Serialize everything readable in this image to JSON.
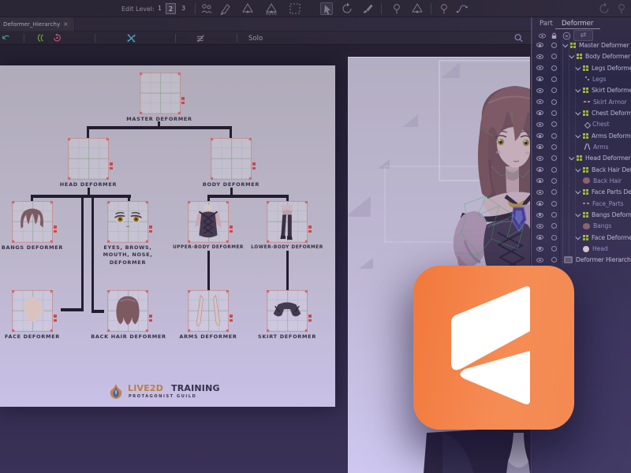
{
  "toolbar": {
    "edit_level_label": "Edit Level:",
    "levels": [
      "1",
      "2",
      "3"
    ],
    "active_level": "2",
    "icons": [
      "users",
      "mesh-pen",
      "lasso-pin",
      "lasso-auto",
      "marquee",
      "spin",
      "cursor-arrow",
      "rotate",
      "brush",
      "lasso-rect",
      "lasso-free",
      "pin",
      "curve",
      "circle-a",
      "circle-b"
    ],
    "auto_label": "AUTO"
  },
  "tabbar": {
    "tab_label": "Deformer_Hierarchy",
    "close_label": "×"
  },
  "quickbar": {
    "solo_label": "Solo",
    "icons": [
      "undo-arc",
      "onion-skin",
      "reset-loop",
      "fit-view",
      "hide-guides",
      "search"
    ]
  },
  "diagram": {
    "nodes": [
      {
        "id": "master",
        "label": "MASTER DEFORMER"
      },
      {
        "id": "head",
        "label": "HEAD DEFORMER"
      },
      {
        "id": "body",
        "label": "BODY DEFORMER"
      },
      {
        "id": "bangs",
        "label": "BANGS DEFORMER"
      },
      {
        "id": "eyes",
        "lines": [
          "EYES, BROWS,",
          "MOUTH, NOSE,",
          "DEFORMER"
        ]
      },
      {
        "id": "upper",
        "label": "UPPER-BODY DEFORMER"
      },
      {
        "id": "lower",
        "label": "LOWER-BODY DEFORMER"
      },
      {
        "id": "face",
        "label": "FACE DEFORMER"
      },
      {
        "id": "backhair",
        "label": "BACK HAIR DEFORMER"
      },
      {
        "id": "arms",
        "label": "ARMS DEFORMER"
      },
      {
        "id": "skirt",
        "label": "SKIRT DEFORMER"
      }
    ],
    "logo": {
      "brand_a": "LIVE2D",
      "brand_b": "TRAINING",
      "subtitle": "PROTAGONIST GUILD"
    }
  },
  "right_panel": {
    "tabs": [
      {
        "label": "Part",
        "active": false
      },
      {
        "label": "Deformer",
        "active": true
      }
    ],
    "rows": [
      {
        "label": "Master Deformer",
        "depth": 0,
        "type": "deformer"
      },
      {
        "label": "Body Deformer",
        "depth": 1,
        "type": "deformer"
      },
      {
        "label": "Legs Deformer",
        "depth": 2,
        "type": "deformer"
      },
      {
        "label": "Legs",
        "depth": 3,
        "type": "art",
        "icon": "dots"
      },
      {
        "label": "Skirt Deformer",
        "depth": 2,
        "type": "deformer"
      },
      {
        "label": "Skirt Armor",
        "depth": 3,
        "type": "art",
        "icon": "pink"
      },
      {
        "label": "Chest Deformer",
        "depth": 2,
        "type": "deformer"
      },
      {
        "label": "Chest",
        "depth": 3,
        "type": "art",
        "icon": "diamond"
      },
      {
        "label": "Arms Deformer",
        "depth": 2,
        "type": "deformer"
      },
      {
        "label": "Arms",
        "depth": 3,
        "type": "art",
        "icon": "slash"
      },
      {
        "label": "Head Deformer",
        "depth": 1,
        "type": "deformer"
      },
      {
        "label": "Back Hair Deformer",
        "depth": 2,
        "type": "deformer"
      },
      {
        "label": "Back Hair",
        "depth": 3,
        "type": "art",
        "icon": "hair"
      },
      {
        "label": "Face Parts Deformer",
        "depth": 2,
        "type": "deformer"
      },
      {
        "label": "Face_Parts",
        "depth": 3,
        "type": "art",
        "icon": "pinkdots"
      },
      {
        "label": "Bangs Deformer",
        "depth": 2,
        "type": "deformer"
      },
      {
        "label": "Bangs",
        "depth": 3,
        "type": "art",
        "icon": "hair"
      },
      {
        "label": "Face Deformer",
        "depth": 2,
        "type": "deformer"
      },
      {
        "label": "Head",
        "depth": 3,
        "type": "art",
        "icon": "circle"
      },
      {
        "label": "Deformer Hierarchy",
        "depth": 0,
        "type": "view",
        "icon": "panel"
      }
    ]
  },
  "colors": {
    "accent_orange": "#f3833f",
    "panel_top": "#2a2847",
    "panel_bottom": "#423b66",
    "canvas_tint": "#b3adc0",
    "connector": "#231d31",
    "deformer_green": "#9db63f"
  }
}
